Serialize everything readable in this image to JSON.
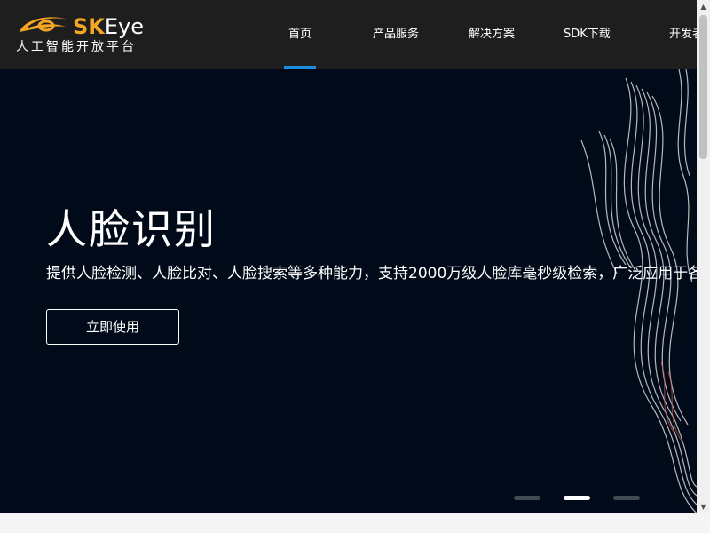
{
  "brand": {
    "name_part1": "SK",
    "name_part2": "Eye",
    "tagline": "人工智能开放平台",
    "accent_color": "#f5a623"
  },
  "nav": {
    "items": [
      {
        "label": "首页",
        "active": true
      },
      {
        "label": "产品服务"
      },
      {
        "label": "解决方案"
      },
      {
        "label": "SDK下载"
      },
      {
        "label": "开发者中心"
      }
    ],
    "active_color": "#1f8ee0"
  },
  "hero": {
    "title": "人脸识别",
    "description": "提供人脸检测、人脸比对、人脸搜索等多种能力，支持2000万级人脸库毫秒级检索，广泛应用于各类场景",
    "button_label": "立即使用",
    "carousel": {
      "count": 3,
      "active_index": 1
    }
  },
  "icons": {
    "logo": "swoosh-logo-icon",
    "scroll_up": "scroll-up-arrow-icon",
    "scroll_down": "scroll-down-arrow-icon"
  }
}
